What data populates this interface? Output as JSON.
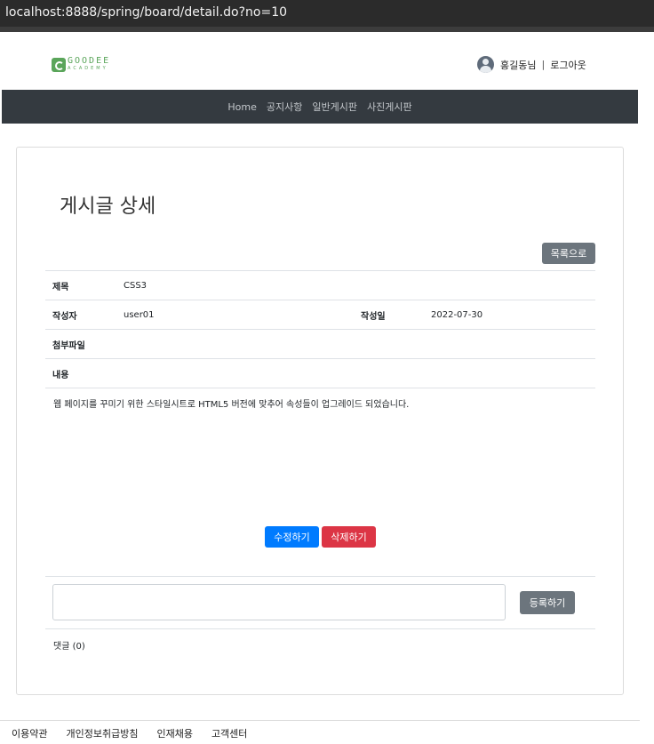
{
  "browser": {
    "url_host": "localhost",
    "url_rest": ":8888/spring/board/detail.do?no=10"
  },
  "header": {
    "logo": {
      "line1": "GOODEE",
      "line2": "ACADEMY"
    },
    "user_name": "홍길동님",
    "separator": "|",
    "logout": "로그아웃"
  },
  "nav": {
    "items": [
      "Home",
      "공지사항",
      "일반게시판",
      "사진게시판"
    ]
  },
  "page": {
    "title": "게시글 상세",
    "list_button": "목록으로"
  },
  "detail": {
    "title_label": "제목",
    "title_value": "CSS3",
    "writer_label": "작성자",
    "writer_value": "user01",
    "date_label": "작성일",
    "date_value": "2022-07-30",
    "attach_label": "첨부파일",
    "attach_value": "",
    "content_label": "내용",
    "content_value": "웹 페이지를 꾸미기 위한 스타일시트로 HTML5 버전에 맞추어 속성들이 업그레이드 되었습니다."
  },
  "actions": {
    "edit": "수정하기",
    "delete": "삭제하기"
  },
  "comments": {
    "input_value": "",
    "submit": "등록하기",
    "count_label": "댓글 (0)"
  },
  "footer": {
    "links": [
      "이용약관",
      "개인정보취급방침",
      "인재채용",
      "고객센터"
    ]
  },
  "colors": {
    "nav_bg": "#343a40",
    "btn_secondary": "#6c757d",
    "btn_primary": "#007bff",
    "btn_danger": "#dc3545",
    "logo_green": "#5aa55a"
  }
}
